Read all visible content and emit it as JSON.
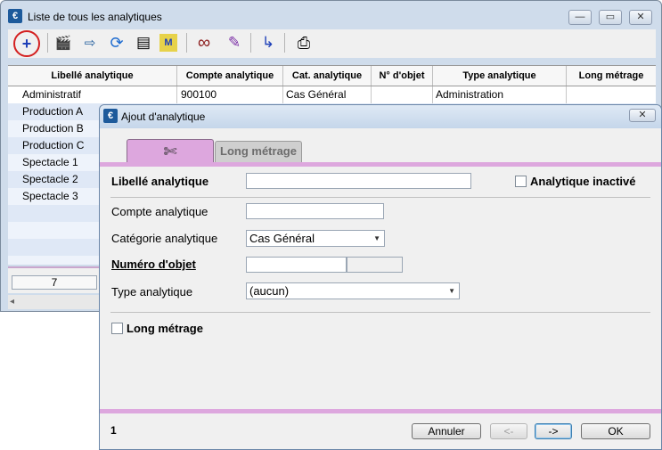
{
  "back_window": {
    "title": "Liste de tous les analytiques",
    "app_icon": "€",
    "controls": {
      "minimize": "—",
      "maximize": "▭",
      "close": "✕"
    },
    "toolbar": [
      {
        "name": "add-icon",
        "glyph": "+"
      },
      {
        "name": "clapperboard-icon",
        "glyph": "🎬"
      },
      {
        "name": "import-icon",
        "glyph": "⇨"
      },
      {
        "name": "refresh-icon",
        "glyph": "⟳"
      },
      {
        "name": "list-icon",
        "glyph": "▤"
      },
      {
        "name": "memo-icon",
        "glyph": "M"
      },
      {
        "name": "glasses-icon",
        "glyph": "∞"
      },
      {
        "name": "pencil-icon",
        "glyph": "✎"
      },
      {
        "name": "navigate-icon",
        "glyph": "↳"
      },
      {
        "name": "print-icon",
        "glyph": "⎙"
      }
    ],
    "columns": [
      "Libellé analytique",
      "Compte analytique",
      "Cat. analytique",
      "N° d'objet",
      "Type analytique",
      "Long métrage"
    ],
    "rows": [
      [
        "Administratif",
        "900100",
        "Cas Général",
        "",
        "Administration",
        ""
      ],
      [
        "Production A",
        "",
        "",
        "",
        "",
        ""
      ],
      [
        "Production B",
        "",
        "",
        "",
        "",
        ""
      ],
      [
        "Production C",
        "",
        "",
        "",
        "",
        ""
      ],
      [
        "Spectacle 1",
        "",
        "",
        "",
        "",
        ""
      ],
      [
        "Spectacle 2",
        "",
        "",
        "",
        "",
        ""
      ],
      [
        "Spectacle 3",
        "",
        "",
        "",
        "",
        ""
      ]
    ],
    "count": "7",
    "scroll_left_arrow": "◂"
  },
  "dialog": {
    "title": "Ajout d'analytique",
    "app_icon": "€",
    "close": "✕",
    "tabs": {
      "first_icon": "✄",
      "second_label": "Long métrage"
    },
    "fields": {
      "libelle_label": "Libellé analytique",
      "libelle_value": "",
      "inactif_label": "Analytique inactivé",
      "compte_label": "Compte analytique",
      "compte_value": "",
      "categorie_label": "Catégorie analytique",
      "categorie_value": "Cas Général",
      "numero_label": "Numéro d'objet",
      "numero_value": "",
      "numero_value2": "",
      "type_label": "Type analytique",
      "type_value": "(aucun)",
      "long_metrage_label": "Long métrage"
    },
    "footer": {
      "page": "1",
      "annuler": "Annuler",
      "prev": "<-",
      "next": "->",
      "ok": "OK"
    }
  }
}
